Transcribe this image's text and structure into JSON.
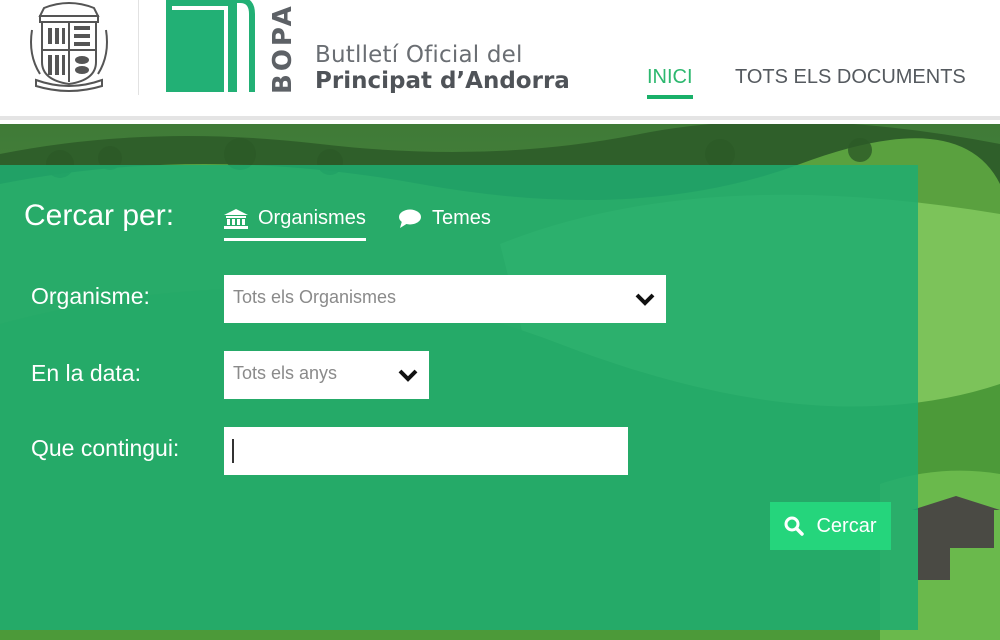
{
  "header": {
    "brand_short": "BOPA",
    "brand_line1": "Butlletí Oficial del",
    "brand_line2": "Principat d’Andorra",
    "nav": [
      {
        "label": "INICI",
        "active": true
      },
      {
        "label": "TOTS ELS DOCUMENTS",
        "active": false
      }
    ]
  },
  "search": {
    "heading": "Cercar per:",
    "tabs": [
      {
        "label": "Organismes",
        "icon": "institution-icon",
        "active": true
      },
      {
        "label": "Temes",
        "icon": "speech-bubble-icon",
        "active": false
      }
    ],
    "fields": {
      "organisme": {
        "label": "Organisme:",
        "value": "Tots els Organismes"
      },
      "data": {
        "label": "En la data:",
        "value": "Tots els anys"
      },
      "contingut": {
        "label": "Que contingui:",
        "value": ""
      }
    },
    "button": {
      "label": "Cercar",
      "icon": "search-icon"
    }
  },
  "colors": {
    "accent": "#19b069",
    "panel": "#1fac70",
    "button": "#25d57c",
    "text_dark": "#4f5358"
  }
}
